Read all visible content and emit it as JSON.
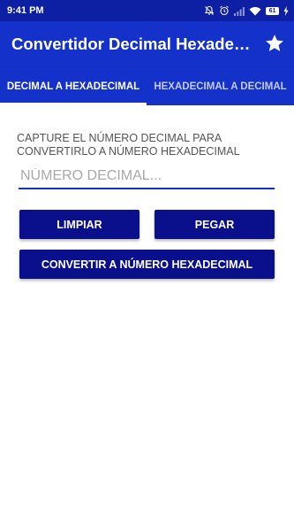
{
  "status_bar": {
    "time": "9:41 PM",
    "battery_level": "61",
    "icons": [
      "mute-icon",
      "alarm-icon",
      "signal-icon",
      "wifi-icon",
      "battery-icon",
      "charging-icon"
    ]
  },
  "app_bar": {
    "title": "Convertidor Decimal Hexadecimal",
    "action_icon": "star-icon"
  },
  "tabs": [
    {
      "label": "DECIMAL A HEXADECIMAL",
      "selected": true
    },
    {
      "label": "HEXADECIMAL A DECIMAL",
      "selected": false
    }
  ],
  "form": {
    "instruction": "CAPTURE EL NÚMERO DECIMAL PARA CONVERTIRLO A NÚMERO HEXADECIMAL",
    "input_value": "",
    "input_placeholder": "NÚMERO DECIMAL..."
  },
  "buttons": {
    "clear_label": "LIMPIAR",
    "paste_label": "PEGAR",
    "convert_label": "CONVERTIR A NÚMERO HEXADECIMAL"
  },
  "colors": {
    "status_bar": "#0d1fa3",
    "app_bar": "#1431c9",
    "button": "#0a0f8c",
    "accent_underline": "#1431c9"
  }
}
